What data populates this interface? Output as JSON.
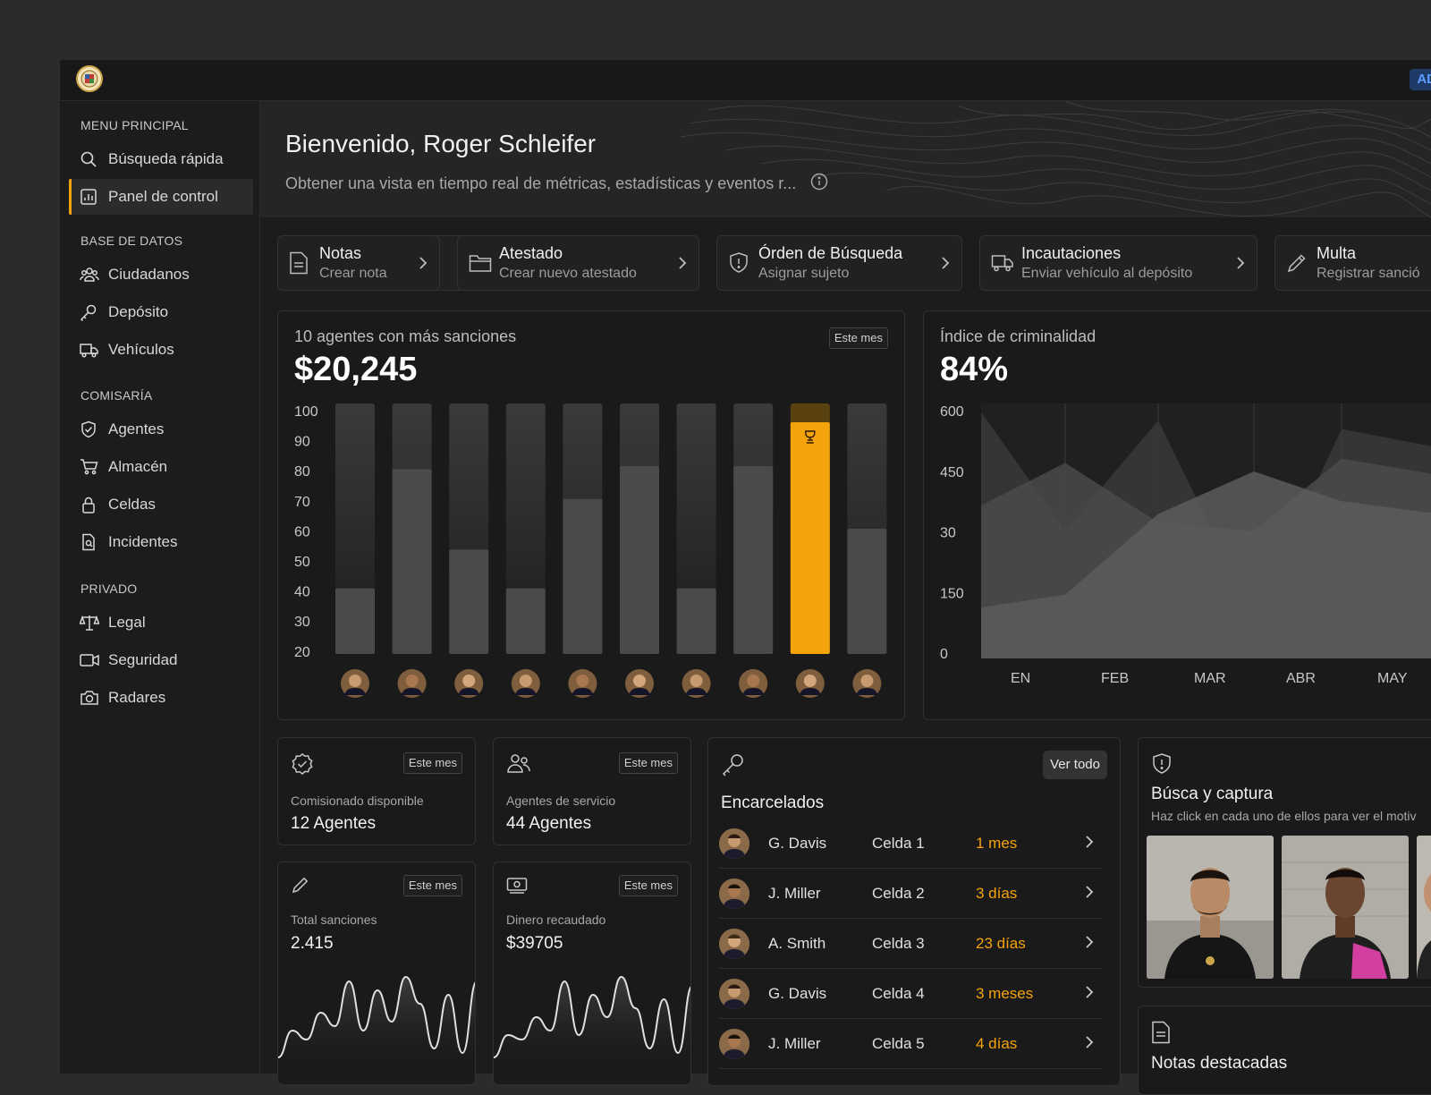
{
  "topbar": {
    "admin_badge": "AD"
  },
  "sidebar": {
    "sections": [
      {
        "title": "MENU PRINCIPAL",
        "items": [
          {
            "label": "Búsqueda rápida",
            "icon": "search-icon"
          },
          {
            "label": "Panel de control",
            "icon": "chart-icon",
            "active": true
          }
        ]
      },
      {
        "title": "BASE DE DATOS",
        "items": [
          {
            "label": "Ciudadanos",
            "icon": "users-icon"
          },
          {
            "label": "Depósito",
            "icon": "key-icon"
          },
          {
            "label": "Vehículos",
            "icon": "truck-icon"
          }
        ]
      },
      {
        "title": "COMISARÍA",
        "items": [
          {
            "label": "Agentes",
            "icon": "shield-icon"
          },
          {
            "label": "Almacén",
            "icon": "cart-icon"
          },
          {
            "label": "Celdas",
            "icon": "lock-icon"
          },
          {
            "label": "Incidentes",
            "icon": "file-search-icon"
          }
        ]
      },
      {
        "title": "PRIVADO",
        "items": [
          {
            "label": "Legal",
            "icon": "scale-icon"
          },
          {
            "label": "Seguridad",
            "icon": "video-icon"
          },
          {
            "label": "Radares",
            "icon": "camera-icon"
          }
        ]
      }
    ]
  },
  "hero": {
    "title": "Bienvenido, Roger Schleifer",
    "subtitle": "Obtener una vista en tiempo real de métricas, estadísticas y eventos r..."
  },
  "quick_actions": [
    {
      "title": "Notas",
      "subtitle": "Crear nota",
      "icon": "note-icon"
    },
    {
      "title": "Atestado",
      "subtitle": "Crear nuevo atestado",
      "icon": "folder-icon"
    },
    {
      "title": "Órden de Búsqueda",
      "subtitle": "Asignar sujeto",
      "icon": "shield-alert-icon"
    },
    {
      "title": "Incautaciones",
      "subtitle": "Enviar vehículo al depósito",
      "icon": "truck-icon"
    },
    {
      "title": "Multa",
      "subtitle": "Registrar sanció",
      "icon": "pencil-icon"
    }
  ],
  "top_agents": {
    "label": "10 agentes con más sanciones",
    "value": "$20,245",
    "period": "Este mes"
  },
  "crime_index": {
    "label": "Índice de criminalidad",
    "value": "84%"
  },
  "chart_data": [
    {
      "type": "bar",
      "categories": [
        "1",
        "2",
        "3",
        "4",
        "5",
        "6",
        "7",
        "8",
        "9",
        "10"
      ],
      "values": [
        38,
        78,
        51,
        38,
        68,
        79,
        38,
        79,
        100,
        58
      ],
      "highlight_index": 8,
      "ylim": [
        16,
        100
      ],
      "yticks": [
        "100",
        "90",
        "80",
        "70",
        "60",
        "50",
        "40",
        "30",
        "20"
      ],
      "highlight_color": "#f5a30d",
      "bar_color": "#4a4a4a"
    },
    {
      "type": "area",
      "x": [
        "EN",
        "FEB",
        "MAR",
        "ABR",
        "MAY"
      ],
      "ylim": [
        0,
        600
      ],
      "yticks": [
        "600",
        "450",
        "30",
        "150",
        "0"
      ],
      "series": [
        {
          "values": [
            580,
            300,
            560,
            100,
            540
          ]
        },
        {
          "values": [
            360,
            460,
            320,
            300,
            470
          ]
        },
        {
          "values": [
            120,
            150,
            340,
            440,
            370
          ]
        }
      ]
    },
    {
      "type": "line",
      "values": [
        10,
        40,
        30,
        60,
        45,
        95,
        40,
        85,
        50,
        100,
        70,
        20,
        80,
        15,
        95
      ]
    },
    {
      "type": "line",
      "values": [
        10,
        35,
        30,
        55,
        40,
        95,
        35,
        80,
        55,
        100,
        65,
        20,
        75,
        15,
        90
      ]
    }
  ],
  "stats": [
    {
      "label": "Comisionado disponible",
      "value": "12 Agentes",
      "period": "Este mes",
      "icon": "check-badge-icon"
    },
    {
      "label": "Agentes de servicio",
      "value": "44 Agentes",
      "period": "Este mes",
      "icon": "users-icon"
    },
    {
      "label": "Total sanciones",
      "value": "2.415",
      "period": "Este mes",
      "icon": "pencil-icon"
    },
    {
      "label": "Dinero recaudado",
      "value": "$39705",
      "period": "Este mes",
      "icon": "money-icon"
    }
  ],
  "jailed": {
    "title": "Encarcelados",
    "view_all": "Ver todo",
    "rows": [
      {
        "name": "G. Davis",
        "cell": "Celda 1",
        "time": "1 mes"
      },
      {
        "name": "J. Miller",
        "cell": "Celda 2",
        "time": "3 días"
      },
      {
        "name": "A. Smith",
        "cell": "Celda 3",
        "time": "23 días"
      },
      {
        "name": "G. Davis",
        "cell": "Celda 4",
        "time": "3 meses"
      },
      {
        "name": "J. Miller",
        "cell": "Celda 5",
        "time": "4 días"
      }
    ]
  },
  "wanted": {
    "title": "Búsca y captura",
    "subtitle": "Haz click en cada uno de ellos para ver el motiv"
  },
  "notes": {
    "title": "Notas destacadas"
  }
}
